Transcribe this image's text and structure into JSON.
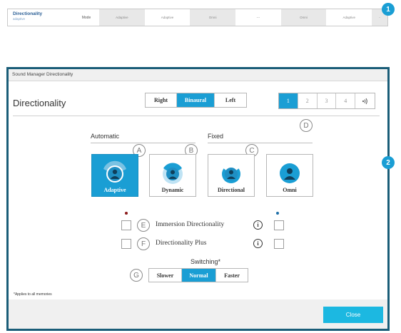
{
  "summary_strip": {
    "title": "Directionality",
    "subtitle": "adaptive",
    "mode_label": "Mode",
    "cells": [
      "Adaptive",
      "Adaptive",
      "Omni",
      "---",
      "Omni",
      "Adaptive",
      "-"
    ]
  },
  "callouts": {
    "one": "1",
    "two": "2"
  },
  "dialog": {
    "window_title": "Sound Manager Directionality",
    "heading": "Directionality",
    "ear_options": [
      "Right",
      "Binaural",
      "Left"
    ],
    "ear_selected": "Binaural",
    "memory_options": [
      "1",
      "2",
      "3",
      "4"
    ],
    "memory_selected": "1",
    "markers": {
      "a": "A",
      "b": "B",
      "c": "C",
      "d": "D",
      "e": "E",
      "f": "F",
      "g": "G"
    },
    "automatic_label": "Automatic",
    "fixed_label": "Fixed",
    "modes": [
      {
        "label": "Adaptive",
        "selected": true
      },
      {
        "label": "Dynamic",
        "selected": false
      },
      {
        "label": "Directional",
        "selected": false
      },
      {
        "label": "Omni",
        "selected": false
      }
    ],
    "immersion_label": "Immersion Directionality",
    "plus_label": "Directionality Plus",
    "info_glyph": "i",
    "switching_label": "Switching*",
    "switching_options": [
      "Slower",
      "Normal",
      "Faster"
    ],
    "switching_selected": "Normal",
    "note": "*Applies to all memories",
    "close_label": "Close"
  },
  "colors": {
    "accent": "#1a9ed4",
    "frame": "#1a5d78",
    "close": "#1cb8e1",
    "left_ear_dot": "#8b1a1a",
    "right_ear_dot": "#1f6fa8"
  }
}
